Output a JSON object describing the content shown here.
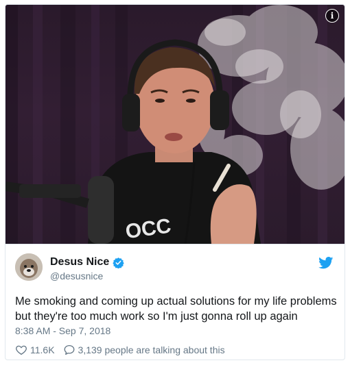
{
  "tweet": {
    "display_name": "Desus Nice",
    "handle": "@desusnice",
    "text": "Me smoking and coming up actual solutions for my life problems but they're too much work so I'm just gonna roll up again",
    "timestamp": "8:38 AM - Sep 7, 2018",
    "likes": "11.6K",
    "conversation": "3,139 people are talking about this",
    "verified": true
  },
  "media": {
    "shirt_text": "OCC"
  },
  "colors": {
    "accent": "#1da1f2",
    "text": "#14171a",
    "muted": "#657786",
    "border": "#e1e8ed"
  },
  "icons": [
    "info-icon",
    "verified-icon",
    "twitter-bird-icon",
    "heart-icon",
    "reply-icon"
  ]
}
